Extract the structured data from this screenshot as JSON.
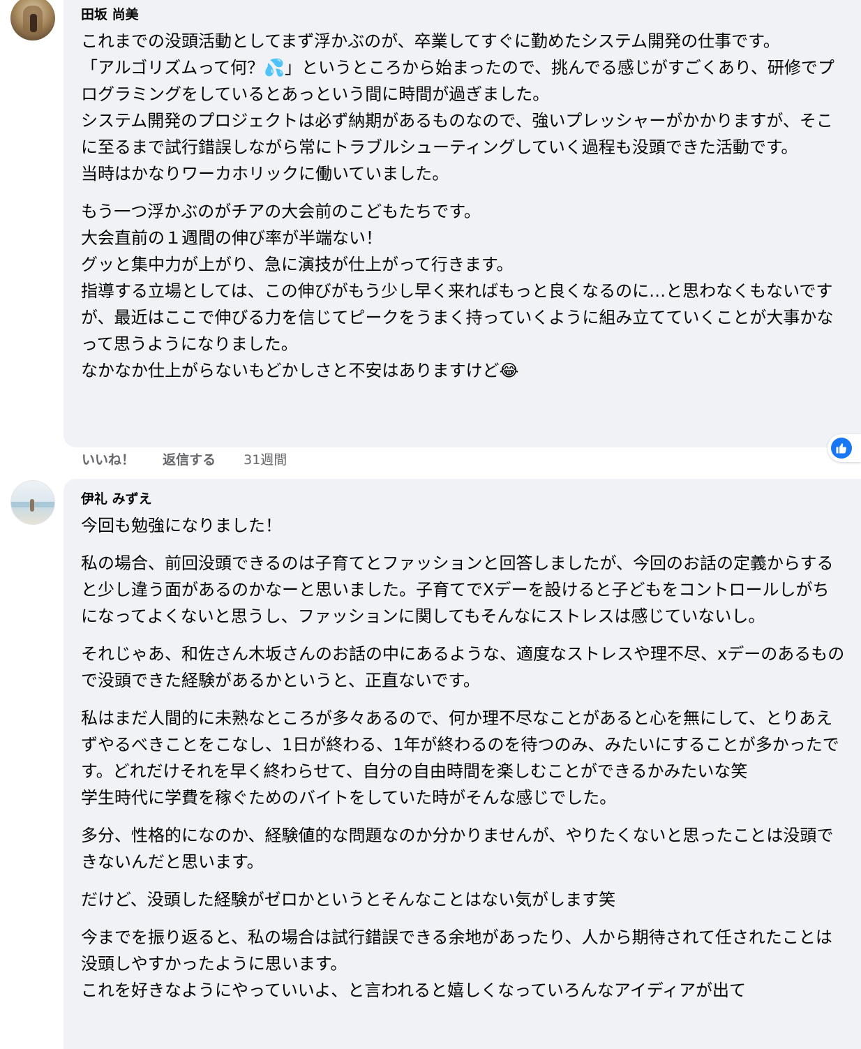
{
  "comment1": {
    "author": "田坂 尚美",
    "paragraphs": [
      "これまでの没頭活動としてまず浮かぶのが、卒業してすぐに勤めたシステム開発の仕事です。",
      "「アルゴリズムって何？💦」というところから始まったので、挑んでる感じがすごくあり、研修でプログラミングをしているとあっという間に時間が過ぎました。",
      "システム開発のプロジェクトは必ず納期があるものなので、強いプレッシャーがかかりますが、そこに至るまで試行錯誤しながら常にトラブルシューティングしていく過程も没頭できた活動です。",
      "当時はかなりワーカホリックに働いていました。",
      "もう一つ浮かぶのがチアの大会前のこどもたちです。",
      "大会直前の１週間の伸び率が半端ない！",
      "グッと集中力が上がり、急に演技が仕上がって行きます。",
      "指導する立場としては、この伸びがもう少し早く来ればもっと良くなるのに…と思わなくもないですが、最近はここで伸びる力を信じてピークをうまく持っていくように組み立てていくことが大事かなって思うようになりました。",
      "なかなか仕上がらないもどかしさと不安はありますけど😂"
    ],
    "actions": {
      "like": "いいね！",
      "reply": "返信する",
      "time": "31週間"
    },
    "icons": {
      "like_reaction": "thumbs-up-icon",
      "avatar": "avatar"
    }
  },
  "comment2": {
    "author": "伊礼 みずえ",
    "paragraphs": [
      "今回も勉強になりました！",
      "私の場合、前回没頭できるのは子育てとファッションと回答しましたが、今回のお話の定義からすると少し違う面があるのかなーと思いました。子育てでXデーを設けると子どもをコントロールしがちになってよくないと思うし、ファッションに関してもそんなにストレスは感じていないし。",
      "それじゃあ、和佐さん木坂さんのお話の中にあるような、適度なストレスや理不尽、xデーのあるもので没頭できた経験があるかというと、正直ないです。",
      "私はまだ人間的に未熟なところが多々あるので、何か理不尽なことがあると心を無にして、とりあえずやるべきことをこなし、1日が終わる、1年が終わるのを待つのみ、みたいにすることが多かったです。どれだけそれを早く終わらせて、自分の自由時間を楽しむことができるかみたいな笑",
      "学生時代に学費を稼ぐためのバイトをしていた時がそんな感じでした。",
      "多分、性格的になのか、経験値的な問題なのか分かりませんが、やりたくないと思ったことは没頭できないんだと思います。",
      "だけど、没頭した経験がゼロかというとそんなことはない気がします笑",
      "今までを振り返ると、私の場合は試行錯誤できる余地があったり、人から期待されて任されたことは没頭しやすかったように思います。",
      "これを好きなようにやっていいよ、と言われると嬉しくなっていろんなアイディアが出て"
    ]
  },
  "colors": {
    "bubble_bg": "#f0f2f5",
    "meta_text": "#65676b",
    "like_blue": "#1877f2",
    "text": "#050505"
  }
}
